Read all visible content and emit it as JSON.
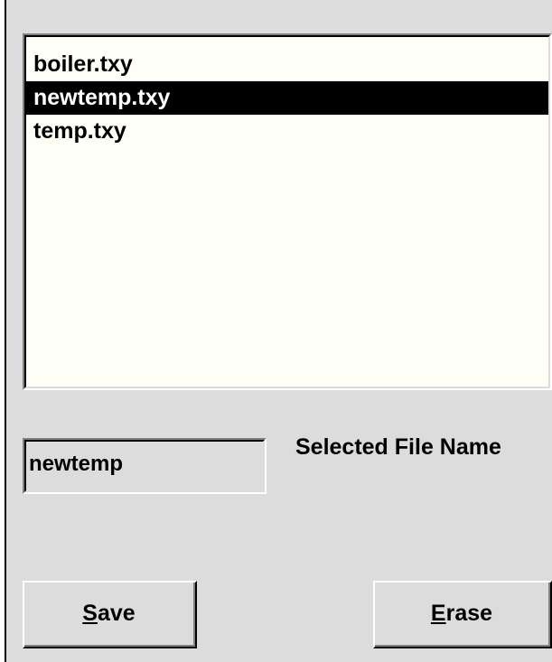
{
  "file_list": {
    "items": [
      {
        "label": "boiler.txy",
        "selected": false
      },
      {
        "label": "newtemp.txy",
        "selected": true
      },
      {
        "label": "temp.txy",
        "selected": false
      }
    ]
  },
  "selected_file": {
    "value": "newtemp",
    "label": "Selected File Name"
  },
  "buttons": {
    "save": {
      "mnemonic": "S",
      "rest": "ave"
    },
    "erase": {
      "mnemonic": "E",
      "rest": "rase"
    }
  },
  "colors": {
    "background": "#dcdcdc",
    "list_background": "#fffff8",
    "selection_background": "#000000",
    "selection_text": "#ffffff"
  }
}
